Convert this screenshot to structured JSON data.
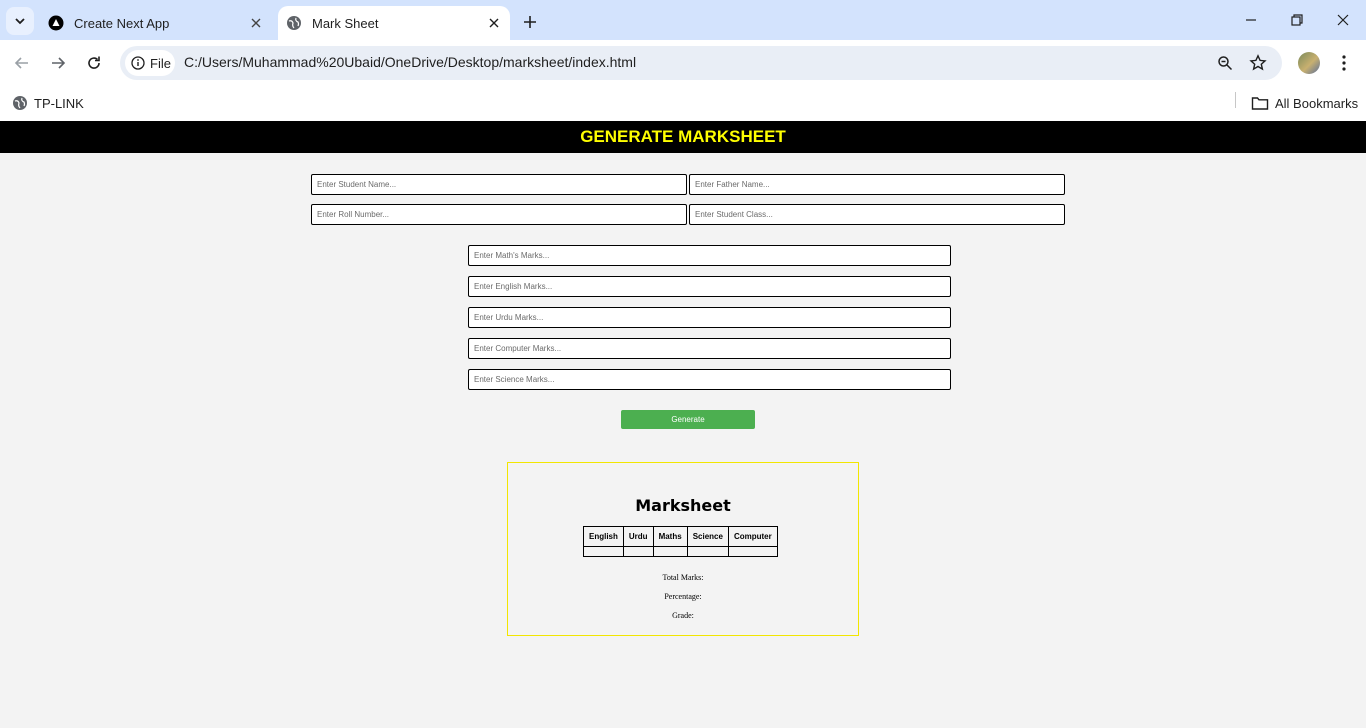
{
  "browser": {
    "tabs": [
      {
        "title": "Create Next App",
        "icon": "nextjs-icon",
        "active": false
      },
      {
        "title": "Mark Sheet",
        "icon": "globe-icon",
        "active": true
      }
    ],
    "address": {
      "chip_label": "File",
      "url": "C:/Users/Muhammad%20Ubaid/OneDrive/Desktop/marksheet/index.html"
    },
    "bookmarks": {
      "left_item": "TP-LINK",
      "all_bookmarks": "All Bookmarks"
    }
  },
  "page": {
    "header": "GENERATE MARKSHEET",
    "student_fields": {
      "name_placeholder": "Enter Student Name...",
      "father_placeholder": "Enter Father Name...",
      "roll_placeholder": "Enter Roll Number...",
      "class_placeholder": "Enter Student Class..."
    },
    "marks_fields": {
      "math_placeholder": "Enter Math's Marks...",
      "english_placeholder": "Enter English Marks...",
      "urdu_placeholder": "Enter Urdu Marks...",
      "computer_placeholder": "Enter Computer Marks...",
      "science_placeholder": "Enter Science Marks..."
    },
    "generate_label": "Generate",
    "marksheet": {
      "title": "Marksheet",
      "columns": [
        "English",
        "Urdu",
        "Maths",
        "Science",
        "Computer"
      ],
      "total_label": "Total Marks:",
      "percentage_label": "Percentage:",
      "grade_label": "Grade:"
    }
  },
  "colors": {
    "header_bg": "#000000",
    "header_text": "#ffff00",
    "button": "#4caf50",
    "sheet_border": "#f2e600"
  }
}
